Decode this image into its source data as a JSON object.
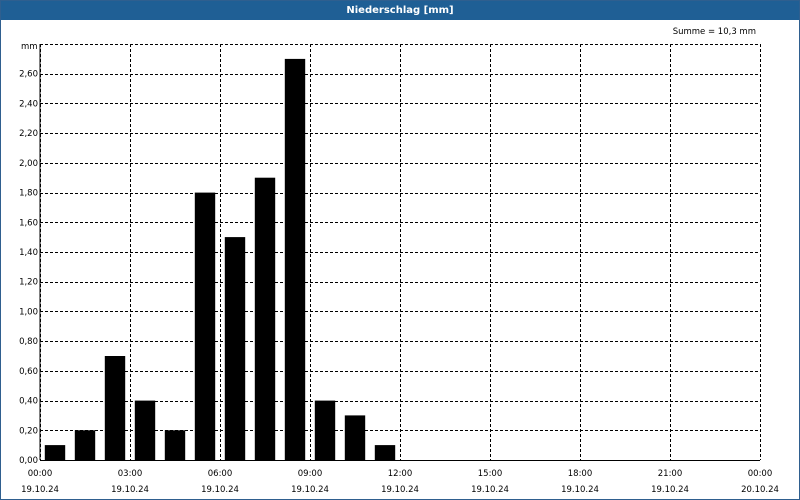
{
  "chart_data": {
    "type": "bar",
    "title": "Niederschlag [mm]",
    "ylabel": "mm",
    "summary": "Summe = 10,3 mm",
    "ylim": [
      0,
      2.8
    ],
    "yticks": [
      "0,00",
      "0,20",
      "0,40",
      "0,60",
      "0,80",
      "1,00",
      "1,20",
      "1,40",
      "1,60",
      "1,80",
      "2,00",
      "2,20",
      "2,40",
      "2,60"
    ],
    "xticks": [
      {
        "time": "00:00",
        "date": "19.10.24"
      },
      {
        "time": "03:00",
        "date": "19.10.24"
      },
      {
        "time": "06:00",
        "date": "19.10.24"
      },
      {
        "time": "09:00",
        "date": "19.10.24"
      },
      {
        "time": "12:00",
        "date": "19.10.24"
      },
      {
        "time": "15:00",
        "date": "19.10.24"
      },
      {
        "time": "18:00",
        "date": "19.10.24"
      },
      {
        "time": "21:00",
        "date": "19.10.24"
      },
      {
        "time": "00:00",
        "date": "20.10.24"
      }
    ],
    "x_hours": [
      0,
      1,
      2,
      3,
      4,
      5,
      6,
      7,
      8,
      9,
      10,
      11
    ],
    "values": [
      0.1,
      0.2,
      0.7,
      0.4,
      0.2,
      1.8,
      1.5,
      1.9,
      2.7,
      0.4,
      0.3,
      0.1
    ],
    "grid": true,
    "legend": "none",
    "colors": {
      "bar": "#000000",
      "title_bg": "#1f5f95",
      "grid": "#000000"
    }
  }
}
